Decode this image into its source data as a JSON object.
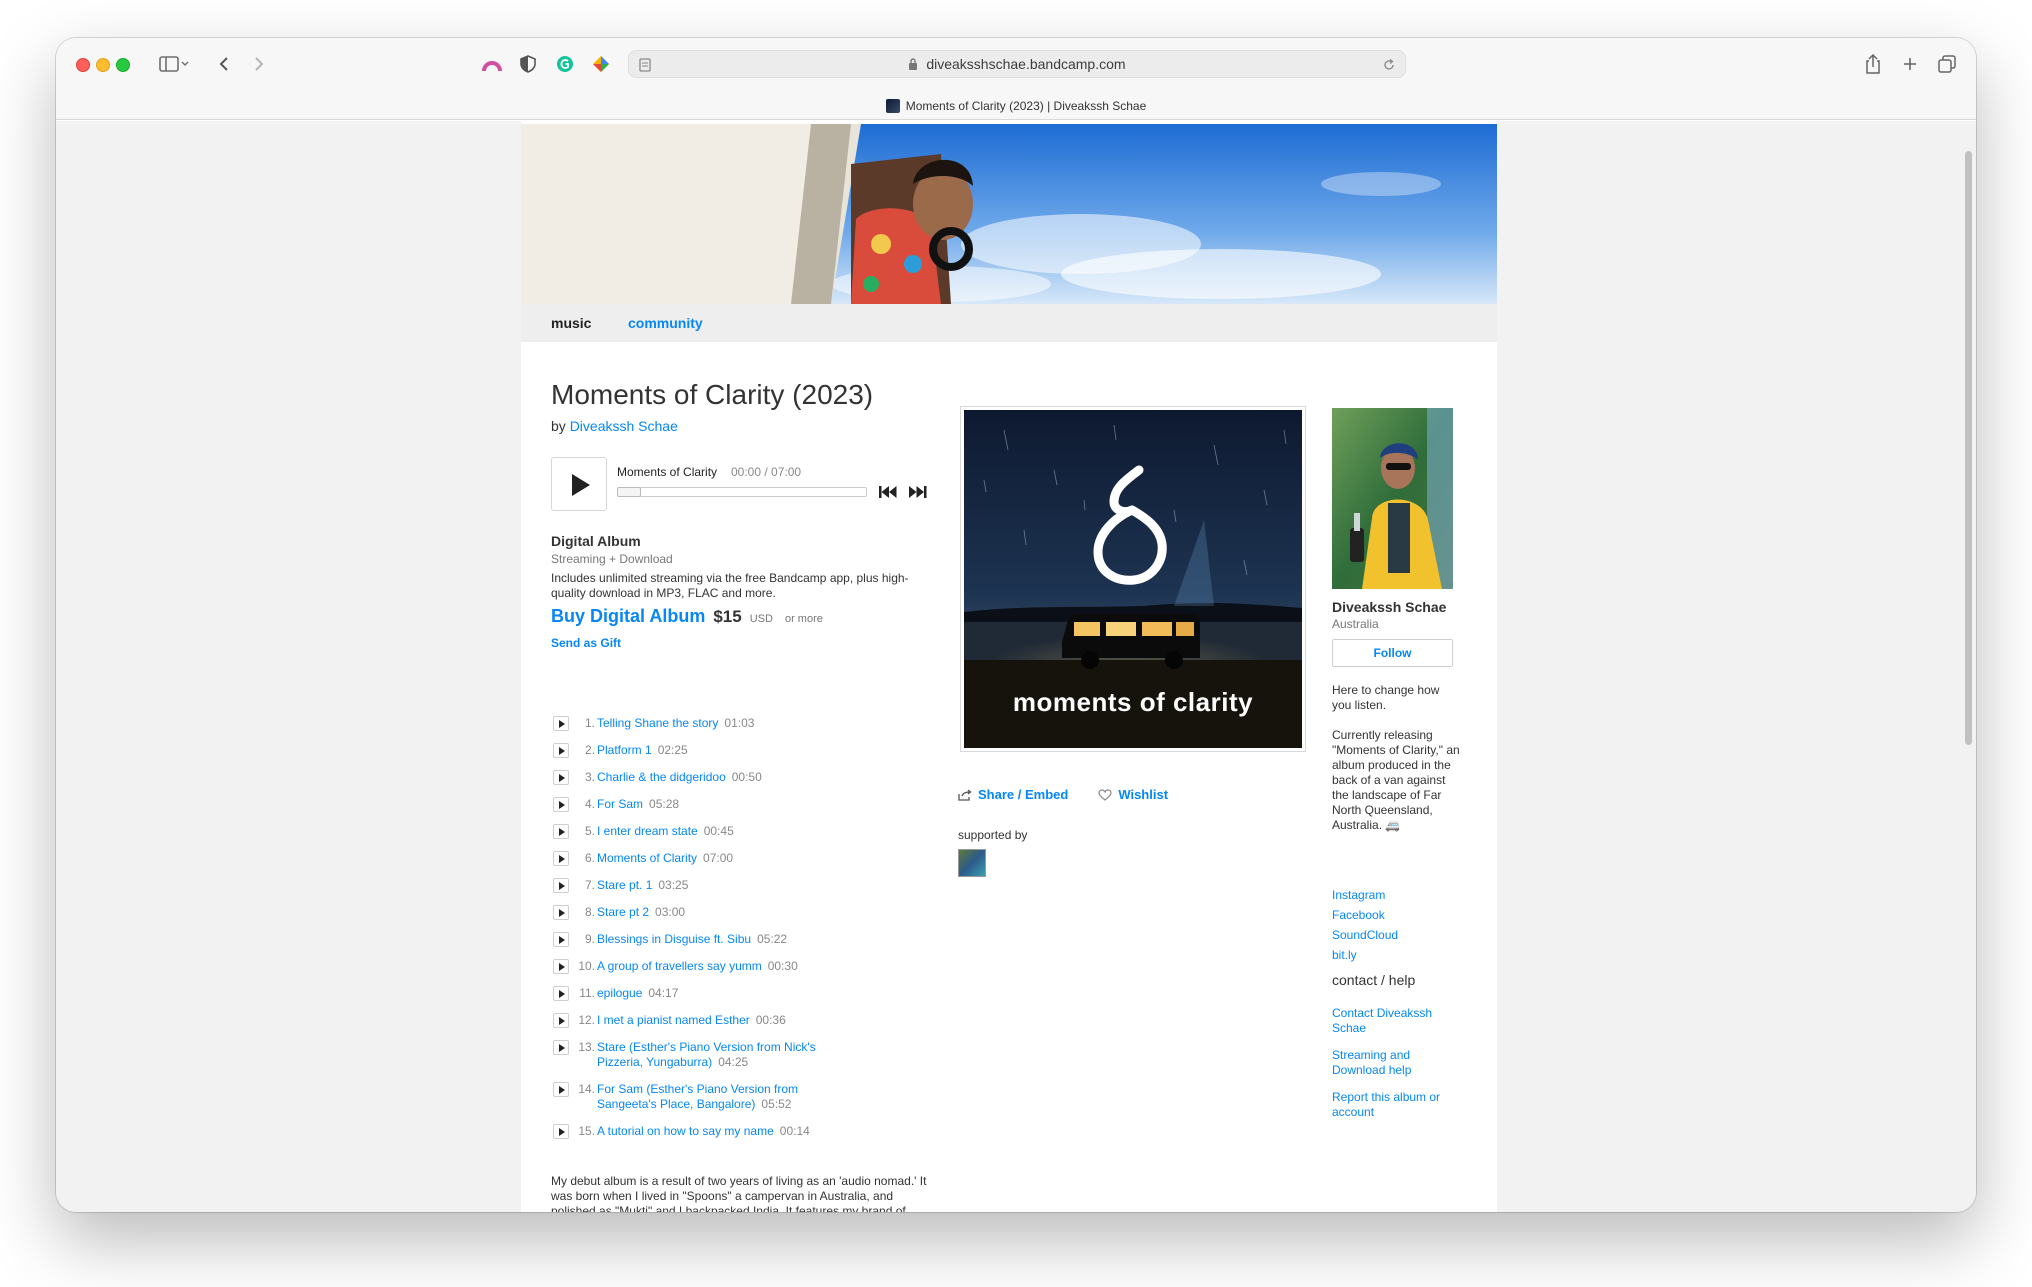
{
  "browser": {
    "url": "diveaksshschae.bandcamp.com",
    "tab_title": "Moments of Clarity (2023) | Diveakssh Schae"
  },
  "nav": {
    "music": "music",
    "community": "community"
  },
  "album": {
    "title": "Moments of Clarity (2023)",
    "by_prefix": "by",
    "artist": "Diveakssh Schae",
    "cover_caption": "moments of clarity"
  },
  "player": {
    "track": "Moments of Clarity",
    "time": "00:00 / 07:00",
    "progress": 0
  },
  "buy": {
    "heading": "Digital Album",
    "subheading": "Streaming + Download",
    "description": "Includes unlimited streaming via the free Bandcamp app, plus high-quality download in MP3, FLAC and more.",
    "buy_label": "Buy Digital Album",
    "price": "$15",
    "currency": "USD",
    "or_more": "or more",
    "gift": "Send as Gift"
  },
  "tracks": [
    {
      "num": "1.",
      "title": "Telling Shane the story",
      "duration": "01:03"
    },
    {
      "num": "2.",
      "title": "Platform 1",
      "duration": "02:25"
    },
    {
      "num": "3.",
      "title": "Charlie & the didgeridoo",
      "duration": "00:50"
    },
    {
      "num": "4.",
      "title": "For Sam",
      "duration": "05:28"
    },
    {
      "num": "5.",
      "title": "I enter dream state",
      "duration": "00:45"
    },
    {
      "num": "6.",
      "title": "Moments of Clarity",
      "duration": "07:00"
    },
    {
      "num": "7.",
      "title": "Stare pt. 1",
      "duration": "03:25"
    },
    {
      "num": "8.",
      "title": "Stare pt 2",
      "duration": "03:00"
    },
    {
      "num": "9.",
      "title": "Blessings in Disguise ft. Sibu",
      "duration": "05:22"
    },
    {
      "num": "10.",
      "title": "A group of travellers say yumm",
      "duration": "00:30"
    },
    {
      "num": "11.",
      "title": "epilogue",
      "duration": "04:17"
    },
    {
      "num": "12.",
      "title": "I met a pianist named Esther",
      "duration": "00:36"
    },
    {
      "num": "13.",
      "title": "Stare (Esther's Piano Version from Nick's Pizzeria, Yungaburra)",
      "duration": "04:25"
    },
    {
      "num": "14.",
      "title": "For Sam (Esther's Piano Version from Sangeeta's Place, Bangalore)",
      "duration": "05:52"
    },
    {
      "num": "15.",
      "title": "A tutorial on how to say my name",
      "duration": "00:14"
    }
  ],
  "about": "My debut album is a result of two years of living as an 'audio nomad.' It was born when I lived in \"Spoons\" a campervan in Australia, and polished as \"Mukti\" and I backpacked India. It features my brand of cinematic electronica, audio stories, and a chance to listen through my ears.",
  "share": {
    "share_embed": "Share / Embed",
    "wishlist": "Wishlist",
    "supported_by": "supported by"
  },
  "artist": {
    "name": "Diveakssh Schae",
    "location": "Australia",
    "follow": "Follow",
    "tagline": "Here to change how you listen.",
    "bio": "Currently releasing \"Moments of Clarity,\" an album produced in the back of a van against the landscape of Far North Queensland, Australia. 🚐",
    "links": [
      "Instagram",
      "Facebook",
      "SoundCloud",
      "bit.ly"
    ],
    "contact_heading": "contact / help",
    "help_links": [
      "Contact Diveakssh Schae",
      "Streaming and Download help",
      "Report this album or account"
    ]
  },
  "colors": {
    "link": "#0687f5",
    "text": "#333333",
    "muted": "#888888"
  }
}
